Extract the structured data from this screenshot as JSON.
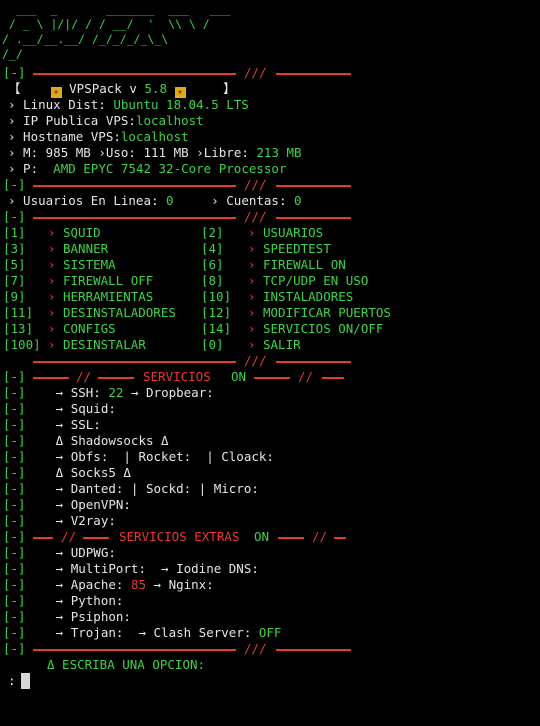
{
  "banner_art": "  ___  _       _______  ___   ___\n / _ \\ |/|/ / / __/  '  \\\\ \\ /\n/ .__/__.__/ /_/_/_/_\\_\\\n/_/",
  "sep_left": "[-]",
  "slashes": "///",
  "title": {
    "name": "VPSPack v",
    "version": "5.8"
  },
  "sys": {
    "dist_label": "› Linux Dist:",
    "dist_value": "Ubuntu 18.04.5 LTS",
    "ip_label": "› IP Publica VPS:",
    "ip_value": "localhost",
    "host_label": "› Hostname VPS:",
    "host_value": "localhost",
    "mem_label": "› M:",
    "mem_total": "985 MB",
    "uso_label": "›Uso:",
    "uso_value": "111 MB",
    "libre_label": "›Libre:",
    "libre_value": "213 MB",
    "cpu_label": "› P:",
    "cpu_value": "AMD EPYC 7542 32-Core Processor"
  },
  "online": {
    "label": "› Usuarios En Linea:",
    "value": "0",
    "cuentas_label": "› Cuentas:",
    "cuentas_value": "0"
  },
  "menu": [
    {
      "n": "[1]",
      "l": "SQUID",
      "n2": "[2]",
      "l2": "USUARIOS"
    },
    {
      "n": "[3]",
      "l": "BANNER",
      "n2": "[4]",
      "l2": "SPEEDTEST"
    },
    {
      "n": "[5]",
      "l": "SISTEMA",
      "n2": "[6]",
      "l2": "FIREWALL ON"
    },
    {
      "n": "[7]",
      "l": "FIREWALL OFF",
      "n2": "[8]",
      "l2": "TCP/UDP EN USO"
    },
    {
      "n": "[9]",
      "l": "HERRAMIENTAS",
      "n2": "[10]",
      "l2": "INSTALADORES"
    },
    {
      "n": "[11]",
      "l": "DESINSTALADORES",
      "n2": "[12]",
      "l2": "MODIFICAR PUERTOS"
    },
    {
      "n": "[13]",
      "l": "CONFIGS",
      "n2": "[14]",
      "l2": "SERVICIOS ON/OFF"
    },
    {
      "n": "[100]",
      "l": "DESINSTALAR",
      "n2": "[0]",
      "l2": "SALIR"
    }
  ],
  "servicios": {
    "slashes_l": "//",
    "title": "SERVICIOS",
    "state": "ON",
    "slashes_r": "//"
  },
  "svc_lines": [
    "[-]    → SSH: 22 → Dropbear:",
    "[-]    → Squid:",
    "[-]    → SSL:",
    "[-]    Δ Shadowsocks Δ",
    "[-]    → Obfs:  | Rocket:  | Cloack:",
    "[-]    Δ Socks5 Δ",
    "[-]    → Danted: | Sockd: | Micro:",
    "[-]    → OpenVPN:",
    "[-]    → V2ray:"
  ],
  "extras": {
    "slashes_l": "//",
    "title": "SERVICIOS EXTRAS",
    "state": "ON",
    "slashes_r": "//"
  },
  "extra_lines": [
    "[-]    → UDPWG:",
    "[-]    → MultiPort:  → Iodine DNS:",
    "[-]    → Apache: 85 → Nginx:",
    "[-]    → Python:",
    "[-]    → Psiphon:",
    "[-]    → Trojan:  → Clash Server: OFF"
  ],
  "prompt": {
    "text": "Δ ESCRIBA UNA OPCION:",
    "cursor_prefix": ":"
  },
  "colors": {
    "green": "#3fd24a",
    "red": "#e53935",
    "white": "#e6e6e6",
    "bg": "#000000"
  }
}
